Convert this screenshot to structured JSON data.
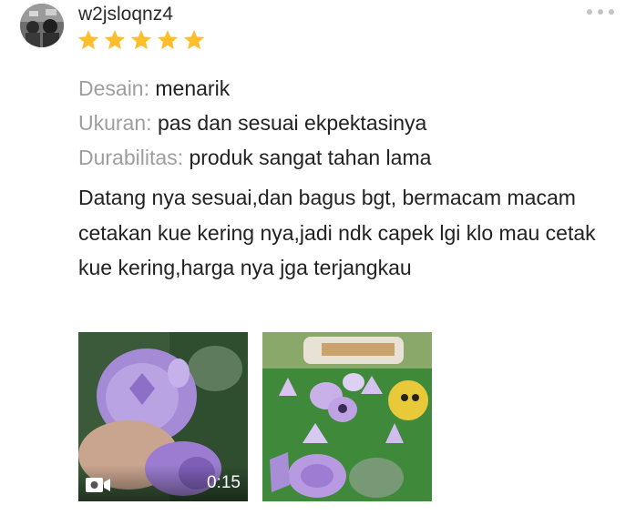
{
  "review": {
    "username": "w2jsloqnz4",
    "rating": 5,
    "attributes": [
      {
        "label": "Desain",
        "value": "menarik"
      },
      {
        "label": "Ukuran",
        "value": "pas dan sesuai ekpektasinya"
      },
      {
        "label": "Durabilitas",
        "value": "produk sangat tahan lama"
      }
    ],
    "text": "Datang nya sesuai,dan bagus bgt, bermacam macam cetakan kue kering nya,jadi ndk capek lgi klo mau cetak kue kering,harga nya jga terjangkau",
    "media": [
      {
        "type": "video",
        "duration": "0:15",
        "icon": "video-camera-icon"
      },
      {
        "type": "photo"
      }
    ]
  },
  "colors": {
    "star": "#fcbf2b",
    "label": "#9e9e9e",
    "text": "#222222"
  }
}
